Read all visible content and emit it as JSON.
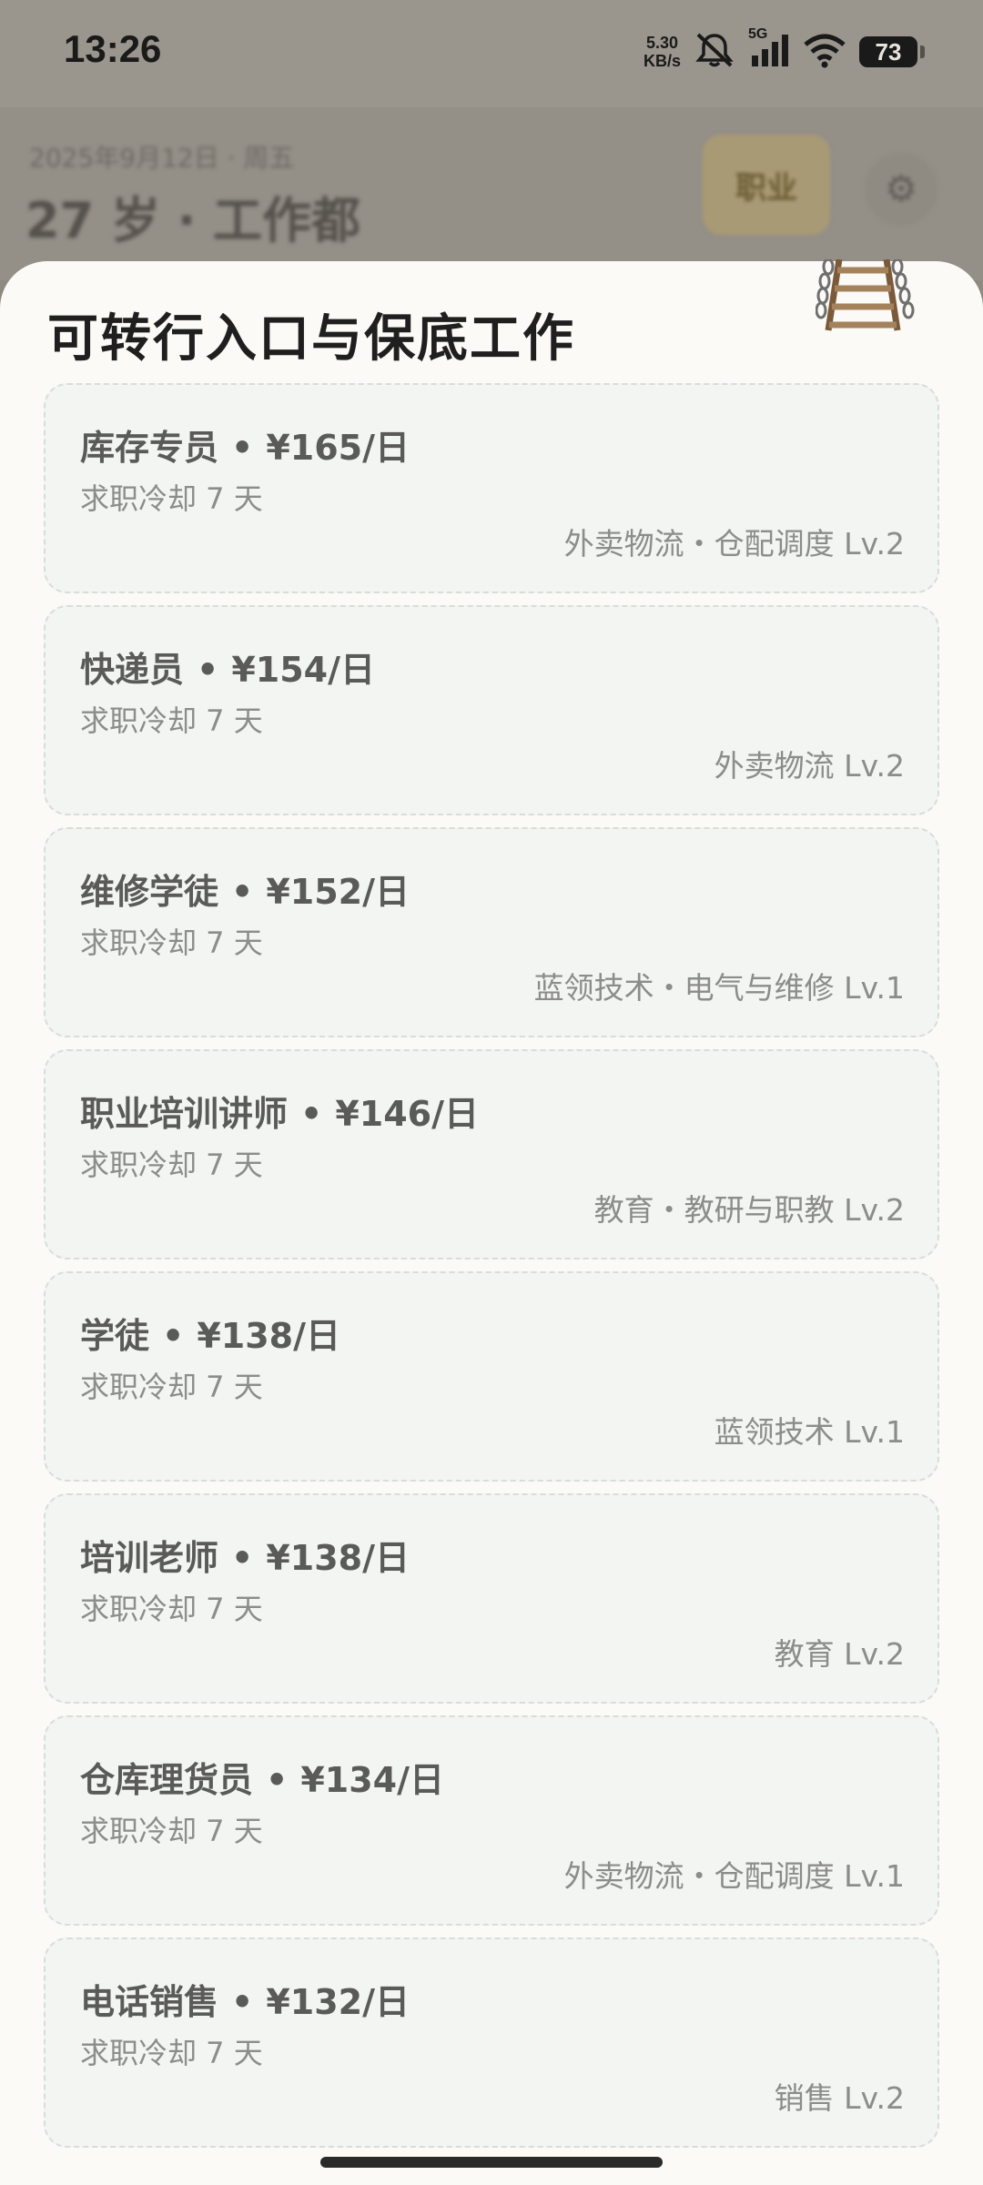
{
  "status_bar": {
    "time": "13:26",
    "net_speed_value": "5.30",
    "net_speed_unit": "KB/s",
    "network_type": "5G",
    "battery": "73"
  },
  "background_page": {
    "subtitle": "2025年9月12日 · 周五",
    "title": "27 岁 · 工作都",
    "badge": "职业"
  },
  "sheet": {
    "title": "可转行入口与保底工作",
    "jobs": [
      {
        "name": "库存专员",
        "pay": "¥165/日",
        "cooldown": "求职冷却 7 天",
        "tag": "外卖物流・仓配调度 Lv.2"
      },
      {
        "name": "快递员",
        "pay": "¥154/日",
        "cooldown": "求职冷却 7 天",
        "tag": "外卖物流 Lv.2"
      },
      {
        "name": "维修学徒",
        "pay": "¥152/日",
        "cooldown": "求职冷却 7 天",
        "tag": "蓝领技术・电气与维修 Lv.1"
      },
      {
        "name": "职业培训讲师",
        "pay": "¥146/日",
        "cooldown": "求职冷却 7 天",
        "tag": "教育・教研与职教 Lv.2"
      },
      {
        "name": "学徒",
        "pay": "¥138/日",
        "cooldown": "求职冷却 7 天",
        "tag": "蓝领技术 Lv.1"
      },
      {
        "name": "培训老师",
        "pay": "¥138/日",
        "cooldown": "求职冷却 7 天",
        "tag": "教育 Lv.2"
      },
      {
        "name": "仓库理货员",
        "pay": "¥134/日",
        "cooldown": "求职冷却 7 天",
        "tag": "外卖物流・仓配调度 Lv.1"
      },
      {
        "name": "电话销售",
        "pay": "¥132/日",
        "cooldown": "求职冷却 7 天",
        "tag": "销售 Lv.2"
      }
    ]
  },
  "separator": "•",
  "icons": {
    "ladder": "ladder-icon",
    "mute": "mute-icon",
    "signal": "signal-icon",
    "wifi": "wifi-icon",
    "gear": "gear-icon"
  }
}
